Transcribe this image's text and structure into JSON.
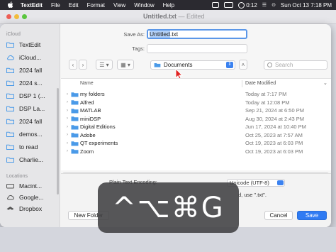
{
  "menubar": {
    "app": "TextEdit",
    "items": [
      "File",
      "Edit",
      "Format",
      "View",
      "Window",
      "Help"
    ],
    "clock_time": "0:12",
    "datetime": "Sun Oct 13  7:18 PM"
  },
  "bg_window": {
    "title": "Untitled.txt",
    "status": "— Edited"
  },
  "sidebar": {
    "icloud_header": "iCloud",
    "icloud_items": [
      "TextEdit",
      "iCloud...",
      "2024 fall",
      "2024 s...",
      "DSP 1 (...",
      "DSP La...",
      "2024 fall",
      "demos...",
      "to read",
      "Charlie..."
    ],
    "locations_header": "Locations",
    "location_items": [
      "Macint...",
      "Google...",
      "Dropbox"
    ]
  },
  "dialog": {
    "save_as_label": "Save As:",
    "filename_base": "Untitled",
    "filename_ext": ".txt",
    "tags_label": "Tags:",
    "location": "Documents",
    "search_placeholder": "Search",
    "col_name": "Name",
    "col_date": "Date Modified",
    "files": [
      {
        "name": "my folders",
        "date": "Today at 7:17 PM"
      },
      {
        "name": "Alfred",
        "date": "Today at 12:08 PM"
      },
      {
        "name": "MATLAB",
        "date": "Sep 21, 2024 at 6:50 PM"
      },
      {
        "name": "miniDSP",
        "date": "Aug 30, 2024 at 2:43 PM"
      },
      {
        "name": "Digital Editions",
        "date": "Jun 17, 2024 at 10:40 PM"
      },
      {
        "name": "Adobe",
        "date": "Oct 25, 2023 at 7:57 AM"
      },
      {
        "name": "QT experiments",
        "date": "Oct 19, 2023 at 6:03 PM"
      },
      {
        "name": "Zoom",
        "date": "Oct 19, 2023 at 6:03 PM"
      }
    ],
    "encoding_label": "Plain Text Encoding:",
    "encoding_value": "Unicode (UTF-8)",
    "ext_note": "d, use \".txt\".",
    "new_folder": "New Folder",
    "cancel": "Cancel",
    "save": "Save"
  },
  "overlay": {
    "shortcut": "^⌥⌘G"
  },
  "colors": {
    "accent": "#2f7bf3",
    "folder": "#4a9ae8",
    "menubar": "#2b2a30"
  }
}
